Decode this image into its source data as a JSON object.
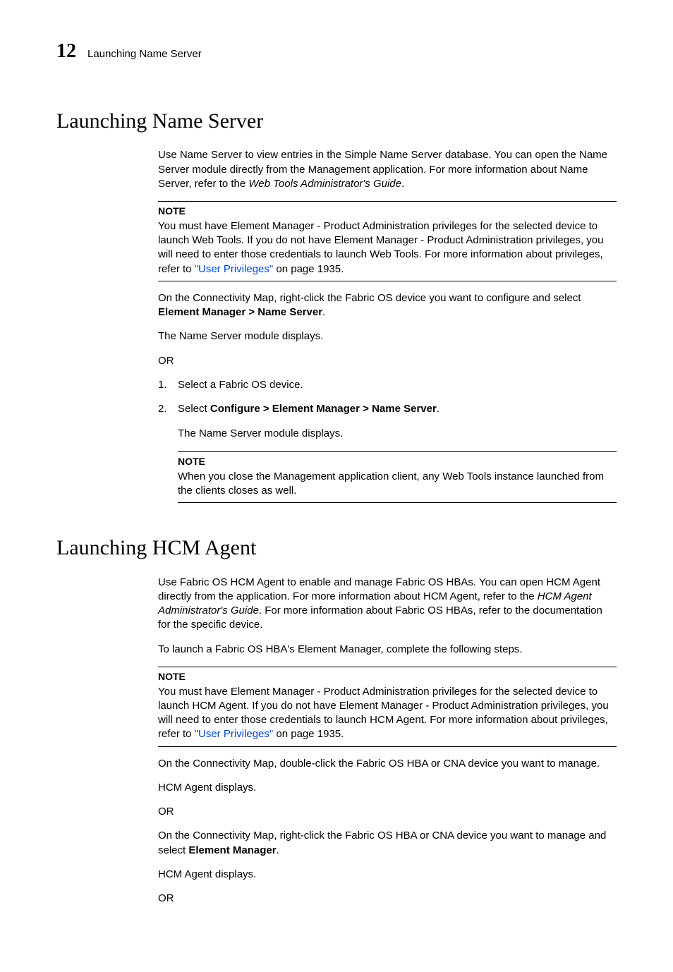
{
  "chapter_number": "12",
  "running_title": "Launching Name Server",
  "s1": {
    "heading": "Launching Name Server",
    "intro_a": "Use Name Server to view entries in the Simple Name Server database. You can open the Name Server module directly from the Management application. For more information about Name Server, refer to the ",
    "intro_italic": "Web Tools Administrator's Guide",
    "intro_b": ".",
    "note1": {
      "label": "NOTE",
      "text_a": "You must have Element Manager - Product Administration privileges for the selected device to launch Web Tools. If you do not have Element Manager - Product Administration privileges, you will need to enter those credentials to launch Web Tools. For more information about privileges, refer to ",
      "link": "\"User Privileges\"",
      "text_b": " on page 1935."
    },
    "p1_a": "On the Connectivity Map, right-click the Fabric OS device you want to configure and select ",
    "p1_bold": "Element Manager > Name Server",
    "p1_b": ".",
    "p2": "The Name Server module displays.",
    "or": "OR",
    "step1": "Select a Fabric OS device.",
    "step2_a": "Select ",
    "step2_bold": "Configure > Element Manager > Name Server",
    "step2_b": ".",
    "step2_result": "The Name Server module displays.",
    "note2": {
      "label": "NOTE",
      "text": "When you close the Management application client, any Web Tools instance launched from the clients closes as well."
    }
  },
  "s2": {
    "heading": "Launching HCM Agent",
    "intro_a": "Use Fabric OS HCM Agent to enable and manage Fabric OS HBAs. You can open HCM Agent directly from the application. For more information about HCM Agent, refer to the ",
    "intro_italic": "HCM Agent Administrator's Guide",
    "intro_b": ". For more information about Fabric OS HBAs, refer to the documentation for the specific device.",
    "p_launch": "To launch a Fabric OS HBA's Element Manager, complete the following steps.",
    "note1": {
      "label": "NOTE",
      "text_a": "You must have Element Manager - Product Administration privileges for the selected device to launch HCM Agent. If you do not have Element Manager - Product Administration privileges, you will need to enter those credentials to launch HCM Agent. For more information about privileges, refer to ",
      "link": "\"User Privileges\"",
      "text_b": " on page 1935."
    },
    "p1": "On the Connectivity Map, double-click the Fabric OS HBA or CNA device you want to manage.",
    "p2": "HCM Agent displays.",
    "or1": "OR",
    "p3_a": "On the Connectivity Map, right-click the Fabric OS HBA or CNA device you want to manage and select ",
    "p3_bold": "Element Manager",
    "p3_b": ".",
    "p4": "HCM Agent displays.",
    "or2": "OR"
  }
}
